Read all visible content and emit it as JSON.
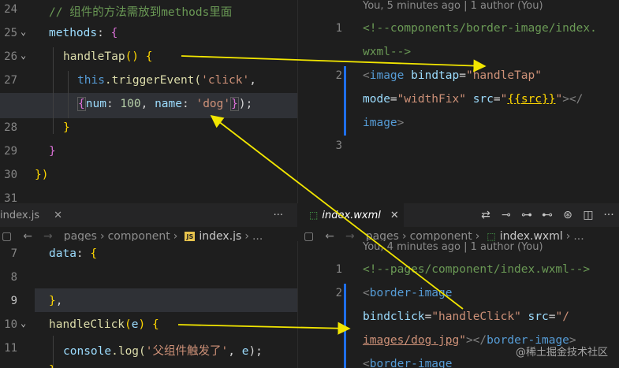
{
  "top_left": {
    "line_numbers": [
      "24",
      "25",
      "26",
      "27",
      "",
      "28",
      "29",
      "30",
      "31"
    ],
    "comment": "// 组件的方法需放到methods里面",
    "methods_key": "methods",
    "handler_name": "handleTap",
    "this_kw": "this",
    "trigger_call": ".triggerEvent(",
    "event_str": "'click'",
    "num_key": "num",
    "num_val": "100",
    "name_key": "name",
    "name_val": "'dog'"
  },
  "top_right": {
    "blame": "You, 5 minutes ago | 1 author (You)",
    "line_numbers": [
      "1",
      "2",
      "3"
    ],
    "comment_line1": "<!--components/border-image/index.",
    "comment_line2": "wxml-->",
    "tag_image": "image",
    "attr_bindtap": "bindtap",
    "val_handleTap": "\"handleTap\"",
    "attr_mode": "mode",
    "val_widthFix": "\"widthFix\"",
    "attr_src": "src",
    "val_src_quote": "\"",
    "val_src_expr": "{{src}}",
    "close_image": "image"
  },
  "tabs": {
    "left_tab": "index.js",
    "left_more": "···",
    "right_tab": "index.wxml",
    "right_more": "···"
  },
  "crumbs_left": {
    "pages": "pages",
    "component": "component",
    "file": "index.js",
    "more": "..."
  },
  "crumbs_right": {
    "pages": "pages",
    "component": "component",
    "file": "index.wxml",
    "more": "..."
  },
  "bottom_left": {
    "line_numbers": [
      "7",
      "8",
      "9",
      "10",
      "11"
    ],
    "data_key": "data",
    "handler_name": "handleClick",
    "param": "e",
    "console": "console",
    "log_call": ".log(",
    "log_str": "'父组件触发了'"
  },
  "bottom_right": {
    "blame": "You, 4 minutes ago | 1 author (You)",
    "line_numbers": [
      "1",
      "2"
    ],
    "comment": "<!--pages/component/index.wxml-->",
    "tag_border_image": "border-image",
    "attr_bindclick": "bindclick",
    "val_handleClick": "\"handleClick\"",
    "attr_src": "src",
    "val_src_start": "\"/",
    "val_src_path": "images/dog.jpg",
    "close_tag": "border-image"
  },
  "watermark": "@稀土掘金技术社区",
  "colors": {
    "arrow": "#f2e600",
    "background": "#1e1e1e",
    "git_modified": "#1f6feb"
  }
}
